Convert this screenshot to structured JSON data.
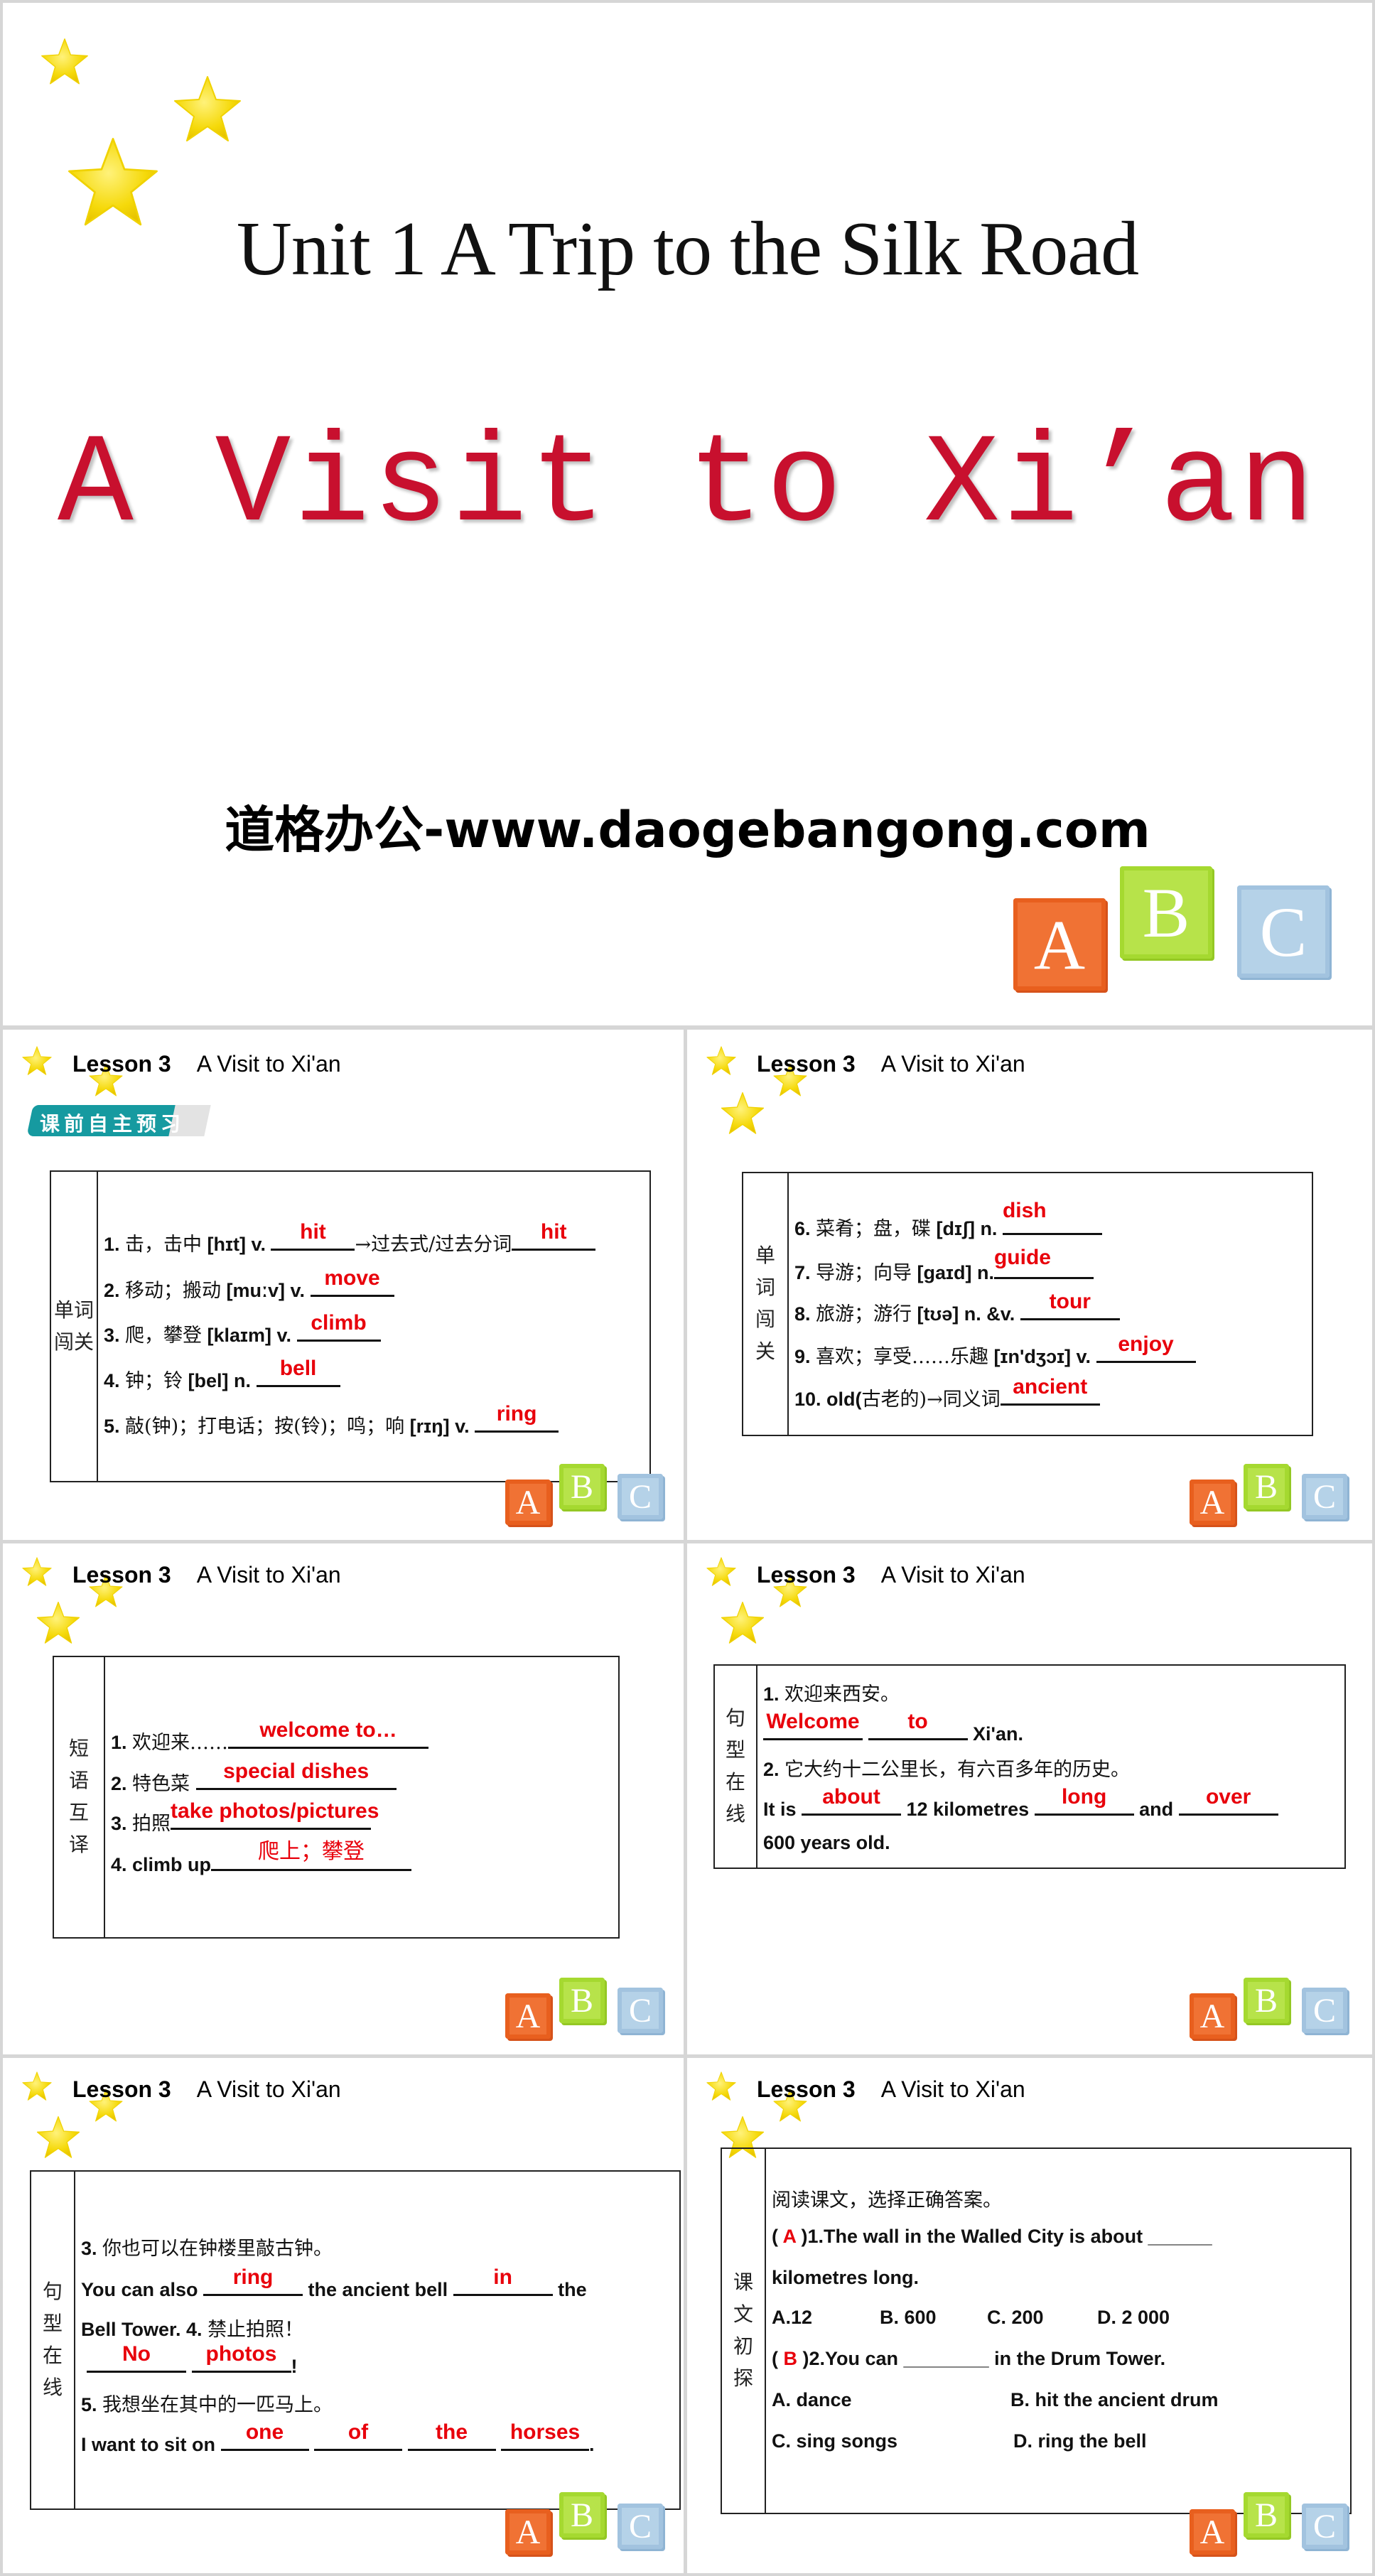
{
  "title_slide": {
    "unit_title": "Unit 1  A Trip to the Silk Road",
    "main_title": "A Visit to Xi’an",
    "website": "道格办公-www.daogebangong.com",
    "blocks": [
      "A",
      "B",
      "C"
    ]
  },
  "lesson_header": {
    "lesson": "Lesson 3",
    "title": "A Visit to Xi'an"
  },
  "colors": {
    "answer": "#e8000b",
    "title_red": "#c8102e",
    "banner_teal": "#169aa0",
    "star": "#f5d90a"
  },
  "slide1": {
    "banner": "课前自主预习",
    "side_label": [
      "单词",
      "闯关"
    ],
    "items": [
      {
        "prefix": "1. ",
        "cn": "击，击中",
        "phon": " [hɪt] v. ",
        "answer": "hit",
        "mid": "→过去式/过去分词",
        "answer2": "hit"
      },
      {
        "prefix": "2. ",
        "cn": "移动；搬动",
        "phon": " [muːv] v. ",
        "answer": "move"
      },
      {
        "prefix": "3. ",
        "cn": "爬，攀登",
        "phon": " [klaɪm] v. ",
        "answer": "climb"
      },
      {
        "prefix": "4. ",
        "cn": "钟；铃",
        "phon": " [bel] n. ",
        "answer": "bell"
      },
      {
        "prefix": "5. ",
        "cn": "敲(钟)；打电话；按(铃)；鸣；响",
        "phon": " [rɪŋ]   v. ",
        "answer": "ring"
      }
    ]
  },
  "slide2": {
    "side_label": [
      "单",
      "词",
      "闯",
      "关"
    ],
    "items": [
      {
        "prefix": "6. ",
        "cn": "菜肴；盘，碟",
        "phon": " [dɪʃ] n. ",
        "answer": "dish"
      },
      {
        "prefix": "7. ",
        "cn": "导游；向导",
        "phon": " [gaɪd] n.",
        "answer": "guide"
      },
      {
        "prefix": "8. ",
        "cn": "旅游；游行",
        "phon": " [tʊə] n.  &v. ",
        "answer": "tour"
      },
      {
        "prefix": "9. ",
        "cn": "喜欢；享受……乐趣",
        "phon": " [ɪn'dʒɔɪ] v. ",
        "answer": "enjoy"
      },
      {
        "prefix": "10. ",
        "cn_pre": "old(",
        "cn": "古老的)→同义词",
        "phon": "",
        "answer": "ancient"
      }
    ]
  },
  "slide3": {
    "side_label": [
      "短",
      "语",
      "互",
      "译"
    ],
    "items": [
      {
        "prefix": "1.  ",
        "cn": "欢迎来……",
        "answer": "welcome to…"
      },
      {
        "prefix": "2.  ",
        "cn": "特色菜 ",
        "answer": "special dishes"
      },
      {
        "prefix": "3.  ",
        "cn": "拍照",
        "answer": "take photos/pictures"
      },
      {
        "prefix": "4.  ",
        "cn": "climb up",
        "answer": "爬上；攀登"
      }
    ]
  },
  "slide4": {
    "side_label": [
      "句",
      "型",
      "在",
      "线"
    ],
    "q1_cn": "欢迎来西安。",
    "q1_prefix": "1.  ",
    "q1_answers": [
      "Welcome",
      "to"
    ],
    "q1_tail": " Xi'an.",
    "q2_prefix": "2.  ",
    "q2_cn": "它大约十二公里长，有六百多年的历史。",
    "q2_parts": [
      "It is ",
      " 12 kilometres ",
      " and "
    ],
    "q2_answers": [
      "about",
      "long",
      "over"
    ],
    "q2_tail": "600 years old."
  },
  "slide5": {
    "side_label": [
      "句",
      "型",
      "在",
      "线"
    ],
    "q3_prefix": "3.  ",
    "q3_cn": "你也可以在钟楼里敲古钟。",
    "q3_parts": [
      "You can also ",
      " the ancient bell ",
      " the"
    ],
    "q3_answers": [
      "ring",
      "in"
    ],
    "q3_line2": "Bell Tower. 4.  ",
    "q4_cn": "禁止拍照！",
    "q4_answers": [
      "No",
      "photos"
    ],
    "q4_tail": "!",
    "q5_prefix": "5.  ",
    "q5_cn": "我想坐在其中的一匹马上。",
    "q5_lead": "I want to sit on ",
    "q5_answers": [
      "one",
      "of",
      "the",
      "horses"
    ],
    "q5_tail": "."
  },
  "slide6": {
    "side_label": [
      "课",
      "文",
      "初",
      "探"
    ],
    "instruction": "阅读课文，选择正确答案。",
    "q1": {
      "open": "(  ",
      "answer": "A",
      "text": " )1.The wall in the Walled City is about ______",
      "text2": "kilometres long.",
      "options": [
        "A.12",
        "B.  600",
        "C.  200",
        "D.  2 000"
      ]
    },
    "q2": {
      "open": "(  ",
      "answer": "B",
      "text": " )2.You can ________ in the Drum Tower.",
      "options": [
        "A.  dance",
        "B.  hit the ancient drum",
        "C.  sing songs",
        "D.  ring the bell"
      ]
    }
  }
}
